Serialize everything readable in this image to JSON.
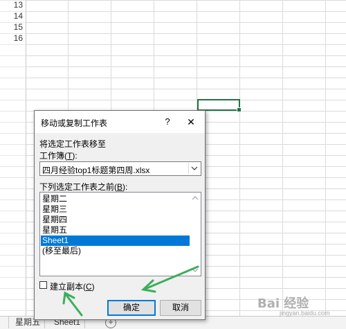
{
  "spreadsheet": {
    "row_numbers": [
      "13",
      "14",
      "15",
      "16"
    ],
    "tabs": [
      "",
      "星期五",
      "Sheet1"
    ],
    "add_sheet_symbol": "+"
  },
  "dialog": {
    "title": "移动或复制工作表",
    "help_symbol": "?",
    "close_symbol": "✕",
    "move_to_label": "将选定工作表移至",
    "workbook_label_pre": "工作簿(",
    "workbook_label_key": "T",
    "workbook_label_post": "):",
    "workbook_value": "四月经验top1标题第四周.xlsx",
    "before_label_pre": "下列选定工作表之前(",
    "before_label_key": "B",
    "before_label_post": "):",
    "sheets": [
      "星期二",
      "星期三",
      "星期四",
      "星期五",
      "Sheet1",
      "(移至最后)"
    ],
    "selected_sheet_index": 4,
    "create_copy_pre": "建立副本(",
    "create_copy_key": "C",
    "create_copy_post": ")",
    "create_copy_checked": false,
    "ok_label": "确定",
    "cancel_label": "取消"
  },
  "annotation": {
    "arrow_color": "#3cae5a"
  },
  "watermark": {
    "text": "Bai  经验",
    "sub": "jingyan.baidu.com"
  },
  "colors": {
    "selection_blue": "#0078d7",
    "excel_green": "#217346"
  }
}
